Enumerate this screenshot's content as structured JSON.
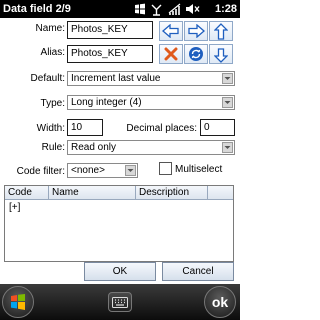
{
  "status_bar": {
    "title": "Data field 2/9",
    "time": "1:28",
    "icons": [
      "windows-flag-icon",
      "network-icon",
      "signal-icon",
      "volume-muted-icon"
    ]
  },
  "form": {
    "name_label": "Name:",
    "name_value": "Photos_KEY",
    "alias_label": "Alias:",
    "alias_value": "Photos_KEY",
    "default_label": "Default:",
    "default_value": "Increment last value",
    "type_label": "Type:",
    "type_value": "Long integer (4)",
    "width_label": "Width:",
    "width_value": "10",
    "decimal_label": "Decimal places:",
    "decimal_value": "0",
    "rule_label": "Rule:",
    "rule_value": "Read only",
    "code_filter_label": "Code filter:",
    "code_filter_value": "<none>",
    "multiselect_label": "Multiselect",
    "multiselect_checked": false
  },
  "toolbar_icons": [
    "arrow-left-icon",
    "arrow-right-icon",
    "arrow-up-icon",
    "delete-x-icon",
    "refresh-icon",
    "arrow-down-icon"
  ],
  "code_table": {
    "columns": [
      "Code",
      "Name",
      "Description"
    ],
    "rows": [
      [
        "[+]",
        "",
        ""
      ]
    ]
  },
  "buttons": {
    "ok": "OK",
    "cancel": "Cancel"
  },
  "softkeys": {
    "right_label": "ok",
    "icons": [
      "start-windows-icon",
      "keyboard-icon"
    ]
  },
  "colors": {
    "status_bar": "#000000",
    "icon_blue": "#1f5fbf",
    "delete_orange": "#e05a1c"
  }
}
